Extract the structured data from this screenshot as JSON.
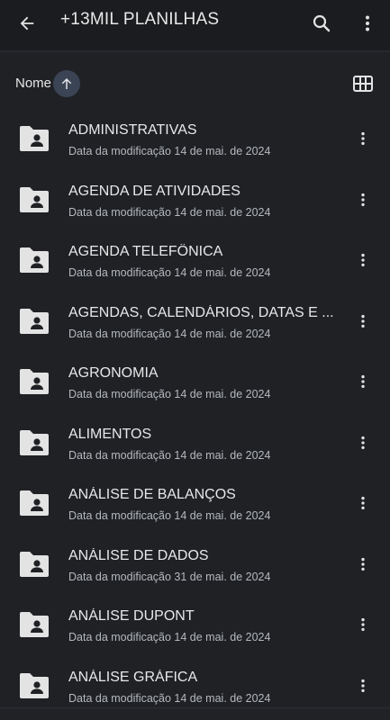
{
  "header": {
    "title": "+13MIL PLANILHAS"
  },
  "sort": {
    "label": "Nome",
    "direction": "ascending"
  },
  "items": [
    {
      "name": "ADMINISTRATIVAS",
      "modified": "Data da modificação 14 de mai. de 2024"
    },
    {
      "name": "AGENDA DE ATIVIDADES",
      "modified": "Data da modificação 14 de mai. de 2024"
    },
    {
      "name": "AGENDA TELEFÔNICA",
      "modified": "Data da modificação 14 de mai. de 2024"
    },
    {
      "name": "AGENDAS, CALENDÁRIOS, DATAS E ...",
      "modified": "Data da modificação 14 de mai. de 2024"
    },
    {
      "name": "AGRONOMIA",
      "modified": "Data da modificação 14 de mai. de 2024"
    },
    {
      "name": "ALIMENTOS",
      "modified": "Data da modificação 14 de mai. de 2024"
    },
    {
      "name": "ANÁLISE DE BALANÇOS",
      "modified": "Data da modificação 14 de mai. de 2024"
    },
    {
      "name": "ANÁLISE DE DADOS",
      "modified": "Data da modificação 31 de mai. de 2024"
    },
    {
      "name": "ANÁLISE DUPONT",
      "modified": "Data da modificação 14 de mai. de 2024"
    },
    {
      "name": "ANÁLISE GRÁFICA",
      "modified": "Data da modificação 14 de mai. de 2024"
    }
  ],
  "colors": {
    "background": "#1f2125",
    "text": "#e8e8e8",
    "secondary_text": "#b5b8bd",
    "sort_button": "#3b4455",
    "icon": "#e3e3e3"
  },
  "icons": {
    "back": "arrow-left-icon",
    "search": "search-icon",
    "more": "more-vert-icon",
    "sort": "arrow-up-icon",
    "view": "grid-view-icon",
    "folder": "shared-folder-icon"
  }
}
